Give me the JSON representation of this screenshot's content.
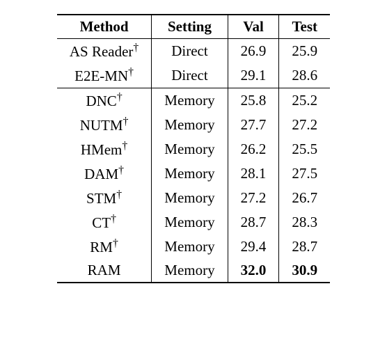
{
  "chart_data": {
    "type": "table",
    "headers": [
      "Method",
      "Setting",
      "Val",
      "Test"
    ],
    "sections": [
      {
        "rows": [
          {
            "method": "AS Reader",
            "dagger": true,
            "setting": "Direct",
            "val": "26.9",
            "test": "25.9"
          },
          {
            "method": "E2E-MN",
            "dagger": true,
            "setting": "Direct",
            "val": "29.1",
            "test": "28.6"
          }
        ]
      },
      {
        "rows": [
          {
            "method": "DNC",
            "dagger": true,
            "setting": "Memory",
            "val": "25.8",
            "test": "25.2"
          },
          {
            "method": "NUTM",
            "dagger": true,
            "setting": "Memory",
            "val": "27.7",
            "test": "27.2"
          },
          {
            "method": "HMem",
            "dagger": true,
            "setting": "Memory",
            "val": "26.2",
            "test": "25.5"
          },
          {
            "method": "DAM",
            "dagger": true,
            "setting": "Memory",
            "val": "28.1",
            "test": "27.5"
          },
          {
            "method": "STM",
            "dagger": true,
            "setting": "Memory",
            "val": "27.2",
            "test": "26.7"
          },
          {
            "method": "CT",
            "dagger": true,
            "setting": "Memory",
            "val": "28.7",
            "test": "28.3"
          },
          {
            "method": "RM",
            "dagger": true,
            "setting": "Memory",
            "val": "29.4",
            "test": "28.7"
          },
          {
            "method": "RAM",
            "dagger": false,
            "setting": "Memory",
            "val": "32.0",
            "test": "30.9",
            "bold_val": true,
            "bold_test": true
          }
        ]
      }
    ]
  }
}
